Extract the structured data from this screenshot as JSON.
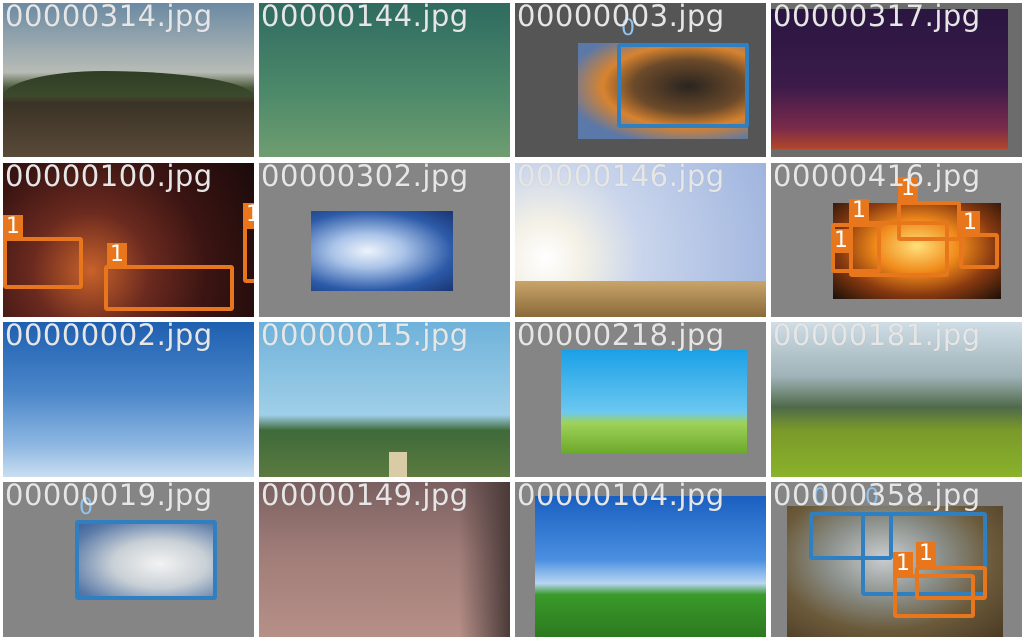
{
  "colors": {
    "class_0": "#2f7fc1",
    "class_1": "#e8761c",
    "filename_text": "#e6e6e6",
    "pad_gray": "#8a8a8a"
  },
  "tiles": [
    {
      "filename": "00000314.jpg",
      "scene": "dusk-field",
      "boxes": []
    },
    {
      "filename": "00000144.jpg",
      "scene": "green-haze",
      "boxes": []
    },
    {
      "filename": "00000003.jpg",
      "scene": "smoke-plume",
      "boxes": [
        {
          "label": "0"
        }
      ]
    },
    {
      "filename": "00000317.jpg",
      "scene": "night-sky",
      "boxes": []
    },
    {
      "filename": "00000100.jpg",
      "scene": "forest-fire-night",
      "boxes": [
        {
          "label": "1"
        },
        {
          "label": "1"
        },
        {
          "label": "1"
        }
      ]
    },
    {
      "filename": "00000302.jpg",
      "scene": "clouds",
      "boxes": []
    },
    {
      "filename": "00000146.jpg",
      "scene": "sunny-wheat",
      "boxes": []
    },
    {
      "filename": "00000416.jpg",
      "scene": "fire-flames",
      "boxes": [
        {
          "label": "1"
        },
        {
          "label": "1"
        },
        {
          "label": "1"
        },
        {
          "label": "1"
        }
      ]
    },
    {
      "filename": "00000002.jpg",
      "scene": "blue-sky",
      "boxes": []
    },
    {
      "filename": "00000015.jpg",
      "scene": "dirt-road",
      "boxes": []
    },
    {
      "filename": "00000218.jpg",
      "scene": "green-field",
      "boxes": []
    },
    {
      "filename": "00000181.jpg",
      "scene": "valley-meadow",
      "boxes": []
    },
    {
      "filename": "00000019.jpg",
      "scene": "mountain-smoke",
      "boxes": [
        {
          "label": "0"
        }
      ]
    },
    {
      "filename": "00000149.jpg",
      "scene": "pink-lake",
      "boxes": []
    },
    {
      "filename": "00000104.jpg",
      "scene": "field-sky",
      "boxes": []
    },
    {
      "filename": "00000358.jpg",
      "scene": "aerial-smoke",
      "boxes": [
        {
          "label": "0"
        },
        {
          "label": "0"
        },
        {
          "label": "1"
        },
        {
          "label": "1"
        }
      ]
    }
  ]
}
